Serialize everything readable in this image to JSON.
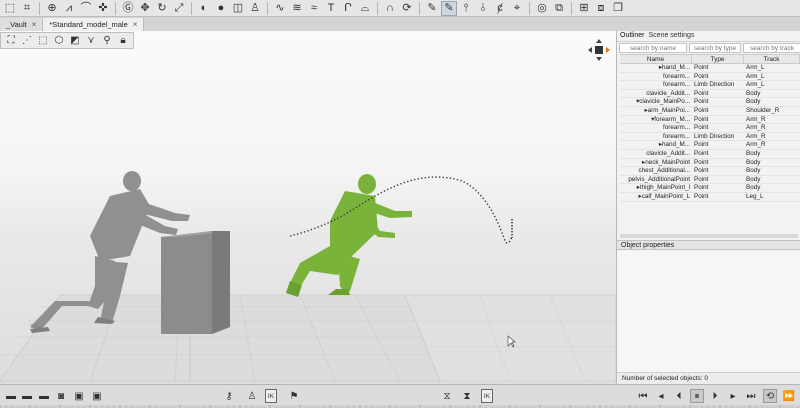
{
  "toolbar": {
    "icons": [
      "select-rect-icon",
      "select-lasso-icon",
      "orbit-icon",
      "graph-icon",
      "curve-icon",
      "pick-icon",
      "group-icon",
      "move-icon",
      "rotate-icon",
      "scale-icon",
      "record-icon",
      "dot-icon",
      "mirror-icon",
      "figure-icon",
      "wave-icon",
      "list-icon",
      "spline-icon",
      "text-tool-icon",
      "bracket-icon",
      "arc-icon",
      "lasso-icon",
      "cycle-icon",
      "pen-icon",
      "pen-active-icon",
      "ik-icon",
      "fk-icon",
      "c-icon",
      "pin-icon",
      "target-icon",
      "layer-icon",
      "grid-icon",
      "window-icon",
      "copy-icon"
    ],
    "text_tool_label": "T"
  },
  "tabs": [
    {
      "label": "_Vault",
      "close": "×"
    },
    {
      "label": "*Standard_model_male",
      "close": "×"
    }
  ],
  "viewport": {
    "tool_icons": [
      "frame-icon",
      "nodes-icon",
      "box-select-icon",
      "box-icon",
      "cube-icon",
      "chevron-icon",
      "bone-icon",
      "lock-icon"
    ]
  },
  "panel": {
    "tabs": [
      "Outliner",
      "Scene settings"
    ],
    "search": {
      "by_name": "search by name",
      "by_type": "search by type",
      "by_track": "search by track"
    },
    "columns": {
      "name": "Name",
      "type": "Type",
      "track": "Track"
    },
    "rows": [
      {
        "name": "▸hand_M...",
        "type": "Point",
        "track": "Arm_L"
      },
      {
        "name": "forearm...",
        "type": "Point",
        "track": "Arm_L"
      },
      {
        "name": "forearm...",
        "type": "Limb Direction",
        "track": "Arm_L"
      },
      {
        "name": "clavicle_Addit...",
        "type": "Point",
        "track": "Body"
      },
      {
        "name": "▾clavicle_MainPo...",
        "type": "Point",
        "track": "Body"
      },
      {
        "name": "▸arm_MainPoi...",
        "type": "Point",
        "track": "Shoulder_R"
      },
      {
        "name": "▾forearm_M...",
        "type": "Point",
        "track": "Arm_R"
      },
      {
        "name": "forearm...",
        "type": "Point",
        "track": "Arm_R"
      },
      {
        "name": "forearm...",
        "type": "Limb Direction",
        "track": "Arm_R"
      },
      {
        "name": "▸hand_M...",
        "type": "Point",
        "track": "Arm_R"
      },
      {
        "name": "clavicle_Addit...",
        "type": "Point",
        "track": "Body"
      },
      {
        "name": "▸neck_MainPoint",
        "type": "Point",
        "track": "Body"
      },
      {
        "name": "chest_Additional...",
        "type": "Point",
        "track": "Body"
      },
      {
        "name": "pelvis_AdditionalPoint",
        "type": "Point",
        "track": "Body"
      },
      {
        "name": "▸thigh_MainPoint_l",
        "type": "Point",
        "track": "Body"
      },
      {
        "name": "▸calf_MainPoint_L",
        "type": "Point",
        "track": "Leg_L"
      }
    ],
    "object_properties": "Object properties",
    "selected_count": "Number of selected objects: 0"
  },
  "bottombar": {
    "ik_label": "IK",
    "frame_label": "IK"
  },
  "colors": {
    "accent_green": "#7ab33a",
    "grey_model": "#8c8c8c",
    "box": "#8a8a8a"
  }
}
